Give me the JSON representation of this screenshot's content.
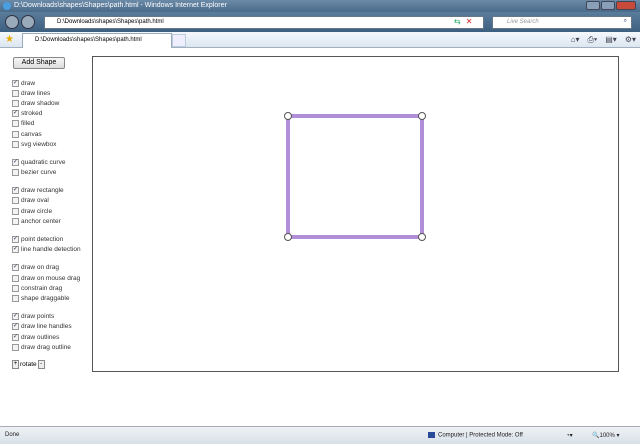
{
  "window": {
    "title": "D:\\Downloads\\shapes\\Shapes\\path.html - Windows Internet Explorer"
  },
  "nav": {
    "address": "D:\\Downloads\\shapes\\Shapes\\path.html",
    "search_placeholder": "Live Search"
  },
  "tab": {
    "label": "D:\\Downloads\\shapes\\Shapes\\path.html"
  },
  "panel": {
    "add_shape_label": "Add Shape",
    "groups": [
      [
        {
          "label": "draw",
          "checked": true
        },
        {
          "label": "draw lines",
          "checked": false
        },
        {
          "label": "draw shadow",
          "checked": false
        },
        {
          "label": "stroked",
          "checked": true
        },
        {
          "label": "filled",
          "checked": false
        },
        {
          "label": "canvas",
          "checked": false
        },
        {
          "label": "svg viewbox",
          "checked": false
        }
      ],
      [
        {
          "label": "quadratic curve",
          "checked": true
        },
        {
          "label": "bezier curve",
          "checked": false
        }
      ],
      [
        {
          "label": "draw rectangle",
          "checked": true
        },
        {
          "label": "draw oval",
          "checked": false
        },
        {
          "label": "draw circle",
          "checked": false
        },
        {
          "label": "anchor center",
          "checked": false
        }
      ],
      [
        {
          "label": "point detection",
          "checked": true
        },
        {
          "label": "line handle detection",
          "checked": true
        }
      ],
      [
        {
          "label": "draw on drag",
          "checked": true
        },
        {
          "label": "draw on mouse drag",
          "checked": false
        },
        {
          "label": "constrain drag",
          "checked": false
        },
        {
          "label": "shape draggable",
          "checked": false
        }
      ],
      [
        {
          "label": "draw points",
          "checked": true
        },
        {
          "label": "draw line handles",
          "checked": true
        },
        {
          "label": "draw outlines",
          "checked": true
        },
        {
          "label": "draw drag outline",
          "checked": false
        }
      ]
    ],
    "rotate_label": "rotate",
    "rotate_left": "+",
    "rotate_right": "-"
  },
  "shape": {
    "stroke_color": "#b08fd8"
  },
  "status": {
    "done": "Done",
    "zone": "Computer | Protected Mode: Off",
    "zoom": "100%"
  }
}
